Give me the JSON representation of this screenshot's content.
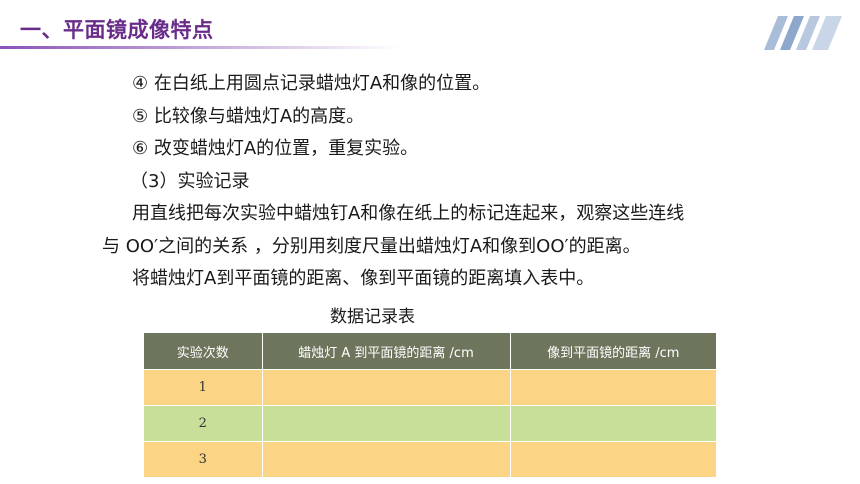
{
  "header": {
    "title": "一、平面镜成像特点"
  },
  "steps": [
    "④ 在白纸上用圆点记录蜡烛灯A和像的位置。",
    "⑤ 比较像与蜡烛灯A的高度。",
    "⑥ 改变蜡烛灯A的位置，重复实验。"
  ],
  "section": {
    "heading": "（3）实验记录",
    "paragraph_line1": "用直线把每次实验中蜡烛钉A和像在纸上的标记连起来，观察这些连线",
    "paragraph_line2": "与 OO′之间的关系 ，分别用刻度尺量出蜡烛灯A和像到OO′的距离。",
    "paragraph_line3": "将蜡烛灯A到平面镜的距离、像到平面镜的距离填入表中。"
  },
  "table": {
    "caption": "数据记录表",
    "headers": [
      "实验次数",
      "蜡烛灯 A 到平面镜的距离 /cm",
      "像到平面镜的距离 /cm"
    ],
    "rows": [
      {
        "trial": "1",
        "candle_distance": "",
        "image_distance": ""
      },
      {
        "trial": "2",
        "candle_distance": "",
        "image_distance": ""
      },
      {
        "trial": "3",
        "candle_distance": "",
        "image_distance": ""
      }
    ],
    "colors": {
      "header_bg": "#6d765c",
      "row_yellow": "#fbd486",
      "row_green": "#c8df9a"
    }
  },
  "theme": {
    "title_color": "#6a2c8a",
    "accent_stripes": "#9fb6d6"
  }
}
